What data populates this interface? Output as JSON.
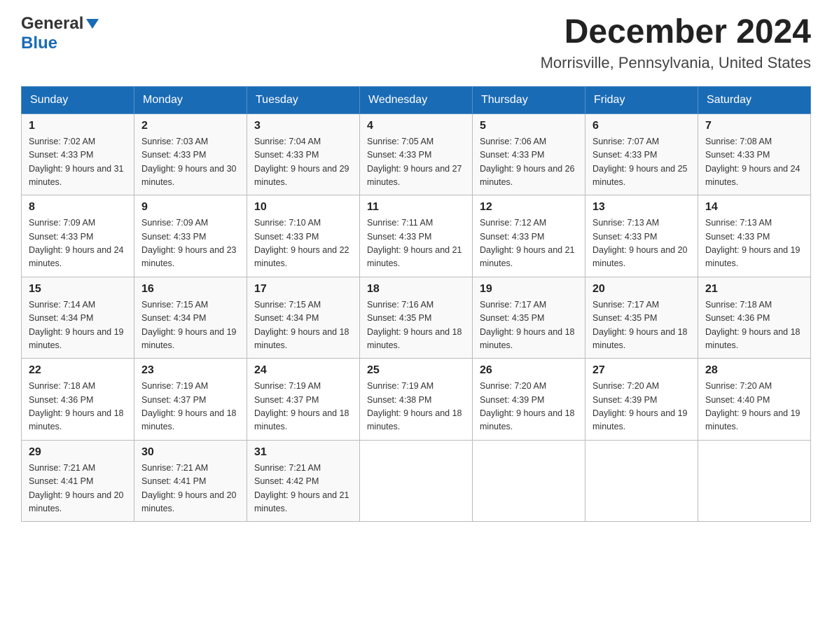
{
  "header": {
    "logo_general": "General",
    "logo_blue": "Blue",
    "title": "December 2024",
    "subtitle": "Morrisville, Pennsylvania, United States"
  },
  "calendar": {
    "days_of_week": [
      "Sunday",
      "Monday",
      "Tuesday",
      "Wednesday",
      "Thursday",
      "Friday",
      "Saturday"
    ],
    "weeks": [
      [
        {
          "date": "1",
          "sunrise": "Sunrise: 7:02 AM",
          "sunset": "Sunset: 4:33 PM",
          "daylight": "Daylight: 9 hours and 31 minutes."
        },
        {
          "date": "2",
          "sunrise": "Sunrise: 7:03 AM",
          "sunset": "Sunset: 4:33 PM",
          "daylight": "Daylight: 9 hours and 30 minutes."
        },
        {
          "date": "3",
          "sunrise": "Sunrise: 7:04 AM",
          "sunset": "Sunset: 4:33 PM",
          "daylight": "Daylight: 9 hours and 29 minutes."
        },
        {
          "date": "4",
          "sunrise": "Sunrise: 7:05 AM",
          "sunset": "Sunset: 4:33 PM",
          "daylight": "Daylight: 9 hours and 27 minutes."
        },
        {
          "date": "5",
          "sunrise": "Sunrise: 7:06 AM",
          "sunset": "Sunset: 4:33 PM",
          "daylight": "Daylight: 9 hours and 26 minutes."
        },
        {
          "date": "6",
          "sunrise": "Sunrise: 7:07 AM",
          "sunset": "Sunset: 4:33 PM",
          "daylight": "Daylight: 9 hours and 25 minutes."
        },
        {
          "date": "7",
          "sunrise": "Sunrise: 7:08 AM",
          "sunset": "Sunset: 4:33 PM",
          "daylight": "Daylight: 9 hours and 24 minutes."
        }
      ],
      [
        {
          "date": "8",
          "sunrise": "Sunrise: 7:09 AM",
          "sunset": "Sunset: 4:33 PM",
          "daylight": "Daylight: 9 hours and 24 minutes."
        },
        {
          "date": "9",
          "sunrise": "Sunrise: 7:09 AM",
          "sunset": "Sunset: 4:33 PM",
          "daylight": "Daylight: 9 hours and 23 minutes."
        },
        {
          "date": "10",
          "sunrise": "Sunrise: 7:10 AM",
          "sunset": "Sunset: 4:33 PM",
          "daylight": "Daylight: 9 hours and 22 minutes."
        },
        {
          "date": "11",
          "sunrise": "Sunrise: 7:11 AM",
          "sunset": "Sunset: 4:33 PM",
          "daylight": "Daylight: 9 hours and 21 minutes."
        },
        {
          "date": "12",
          "sunrise": "Sunrise: 7:12 AM",
          "sunset": "Sunset: 4:33 PM",
          "daylight": "Daylight: 9 hours and 21 minutes."
        },
        {
          "date": "13",
          "sunrise": "Sunrise: 7:13 AM",
          "sunset": "Sunset: 4:33 PM",
          "daylight": "Daylight: 9 hours and 20 minutes."
        },
        {
          "date": "14",
          "sunrise": "Sunrise: 7:13 AM",
          "sunset": "Sunset: 4:33 PM",
          "daylight": "Daylight: 9 hours and 19 minutes."
        }
      ],
      [
        {
          "date": "15",
          "sunrise": "Sunrise: 7:14 AM",
          "sunset": "Sunset: 4:34 PM",
          "daylight": "Daylight: 9 hours and 19 minutes."
        },
        {
          "date": "16",
          "sunrise": "Sunrise: 7:15 AM",
          "sunset": "Sunset: 4:34 PM",
          "daylight": "Daylight: 9 hours and 19 minutes."
        },
        {
          "date": "17",
          "sunrise": "Sunrise: 7:15 AM",
          "sunset": "Sunset: 4:34 PM",
          "daylight": "Daylight: 9 hours and 18 minutes."
        },
        {
          "date": "18",
          "sunrise": "Sunrise: 7:16 AM",
          "sunset": "Sunset: 4:35 PM",
          "daylight": "Daylight: 9 hours and 18 minutes."
        },
        {
          "date": "19",
          "sunrise": "Sunrise: 7:17 AM",
          "sunset": "Sunset: 4:35 PM",
          "daylight": "Daylight: 9 hours and 18 minutes."
        },
        {
          "date": "20",
          "sunrise": "Sunrise: 7:17 AM",
          "sunset": "Sunset: 4:35 PM",
          "daylight": "Daylight: 9 hours and 18 minutes."
        },
        {
          "date": "21",
          "sunrise": "Sunrise: 7:18 AM",
          "sunset": "Sunset: 4:36 PM",
          "daylight": "Daylight: 9 hours and 18 minutes."
        }
      ],
      [
        {
          "date": "22",
          "sunrise": "Sunrise: 7:18 AM",
          "sunset": "Sunset: 4:36 PM",
          "daylight": "Daylight: 9 hours and 18 minutes."
        },
        {
          "date": "23",
          "sunrise": "Sunrise: 7:19 AM",
          "sunset": "Sunset: 4:37 PM",
          "daylight": "Daylight: 9 hours and 18 minutes."
        },
        {
          "date": "24",
          "sunrise": "Sunrise: 7:19 AM",
          "sunset": "Sunset: 4:37 PM",
          "daylight": "Daylight: 9 hours and 18 minutes."
        },
        {
          "date": "25",
          "sunrise": "Sunrise: 7:19 AM",
          "sunset": "Sunset: 4:38 PM",
          "daylight": "Daylight: 9 hours and 18 minutes."
        },
        {
          "date": "26",
          "sunrise": "Sunrise: 7:20 AM",
          "sunset": "Sunset: 4:39 PM",
          "daylight": "Daylight: 9 hours and 18 minutes."
        },
        {
          "date": "27",
          "sunrise": "Sunrise: 7:20 AM",
          "sunset": "Sunset: 4:39 PM",
          "daylight": "Daylight: 9 hours and 19 minutes."
        },
        {
          "date": "28",
          "sunrise": "Sunrise: 7:20 AM",
          "sunset": "Sunset: 4:40 PM",
          "daylight": "Daylight: 9 hours and 19 minutes."
        }
      ],
      [
        {
          "date": "29",
          "sunrise": "Sunrise: 7:21 AM",
          "sunset": "Sunset: 4:41 PM",
          "daylight": "Daylight: 9 hours and 20 minutes."
        },
        {
          "date": "30",
          "sunrise": "Sunrise: 7:21 AM",
          "sunset": "Sunset: 4:41 PM",
          "daylight": "Daylight: 9 hours and 20 minutes."
        },
        {
          "date": "31",
          "sunrise": "Sunrise: 7:21 AM",
          "sunset": "Sunset: 4:42 PM",
          "daylight": "Daylight: 9 hours and 21 minutes."
        },
        null,
        null,
        null,
        null
      ]
    ]
  }
}
